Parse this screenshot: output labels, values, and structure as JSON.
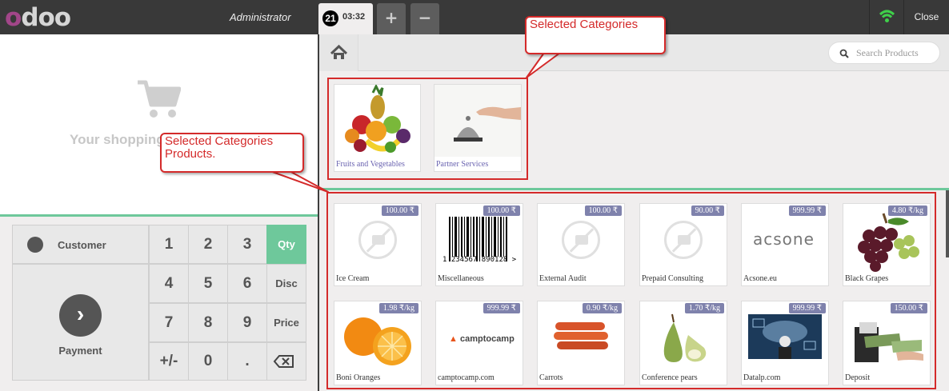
{
  "topbar": {
    "logo": "odoo",
    "user": "Administrator",
    "order_number": "21",
    "order_time": "03:32",
    "add_order_label": "+",
    "remove_order_label": "−",
    "close_label": "Close"
  },
  "cart": {
    "empty_text": "Your shopping cart is empty"
  },
  "numpad": {
    "customer_label": "Customer",
    "payment_label": "Payment",
    "keys": [
      "1",
      "2",
      "3",
      "4",
      "5",
      "6",
      "7",
      "8",
      "9",
      "+/-",
      "0",
      "."
    ],
    "modes": [
      "Qty",
      "Disc",
      "Price"
    ],
    "selected_mode": "Qty"
  },
  "search": {
    "placeholder": "Search Products"
  },
  "categories": [
    {
      "name": "Fruits and Vegetables"
    },
    {
      "name": "Partner Services"
    }
  ],
  "products": [
    {
      "name": "Ice Cream",
      "price": "100.00 ₹",
      "image": "no-image"
    },
    {
      "name": "Miscellaneous",
      "price": "100.00 ₹",
      "image": "barcode",
      "barcode": "1 234567 890128 >"
    },
    {
      "name": "External Audit",
      "price": "100.00 ₹",
      "image": "no-image"
    },
    {
      "name": "Prepaid Consulting",
      "price": "90.00 ₹",
      "image": "no-image"
    },
    {
      "name": "Acsone.eu",
      "price": "999.99 ₹",
      "image": "acsone-logo",
      "logo_text": "acsone"
    },
    {
      "name": "Black Grapes",
      "price": "4.80 ₹/kg",
      "image": "grapes"
    },
    {
      "name": "Boni Oranges",
      "price": "1.98 ₹/kg",
      "image": "oranges"
    },
    {
      "name": "camptocamp.com",
      "price": "999.99 ₹",
      "image": "camptocamp-logo",
      "logo_text": "camptocamp"
    },
    {
      "name": "Carrots",
      "price": "0.90 ₹/kg",
      "image": "carrots"
    },
    {
      "name": "Conference pears",
      "price": "1.70 ₹/kg",
      "image": "pears"
    },
    {
      "name": "Datalp.com",
      "price": "999.99 ₹",
      "image": "datalp"
    },
    {
      "name": "Deposit",
      "price": "150.00 ₹",
      "image": "money"
    }
  ],
  "annotations": {
    "categories_label": "Selected Categories",
    "products_label": "Selected Categories Products."
  },
  "colors": {
    "accent": "#6ec89b",
    "annotation": "#d42a2a",
    "price_tag": "#7f82ac"
  }
}
